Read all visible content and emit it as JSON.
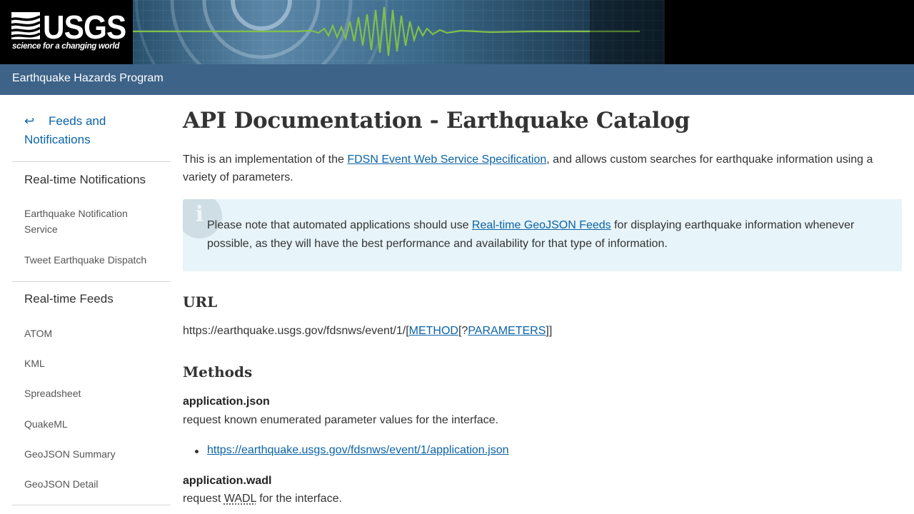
{
  "header": {
    "logo_text": "USGS",
    "logo_tagline": "science for a changing world"
  },
  "program_bar": {
    "title": "Earthquake Hazards Program"
  },
  "sidebar": {
    "back_arrow": "↩",
    "back_label": "Feeds and Notifications",
    "sections": [
      {
        "heading": "Real-time Notifications",
        "items": [
          "Earthquake Notification Service",
          "Tweet Earthquake Dispatch"
        ]
      },
      {
        "heading": "Real-time Feeds",
        "items": [
          "ATOM",
          "KML",
          "Spreadsheet",
          "QuakeML",
          "GeoJSON Summary",
          "GeoJSON Detail"
        ]
      }
    ]
  },
  "main": {
    "title": "API Documentation - Earthquake Catalog",
    "intro_before": "This is an implementation of the ",
    "intro_link": "FDSN Event Web Service Specification",
    "intro_after": ", and allows custom searches for earthquake information using a variety of parameters.",
    "alert": {
      "icon": "info-icon",
      "icon_glyph": "i",
      "before": "Please note that automated applications should use ",
      "link": "Real-time GeoJSON Feeds",
      "after": " for displaying earthquake information whenever possible, as they will have the best performance and availability for that type of information."
    },
    "url_section": {
      "heading": "URL",
      "prefix": "https://earthquake.usgs.gov/fdsnws/event/1/[",
      "method_link": "METHOD",
      "mid": "[?",
      "params_link": "PARAMETERS",
      "suffix": "]]"
    },
    "methods_section": {
      "heading": "Methods",
      "methods": [
        {
          "name": "application.json",
          "description": "request known enumerated parameter values for the interface.",
          "link": "https://earthquake.usgs.gov/fdsnws/event/1/application.json"
        },
        {
          "name": "application.wadl",
          "description_before": "request ",
          "description_abbr": "WADL",
          "description_after": " for the interface."
        }
      ]
    }
  },
  "colors": {
    "header_bg": "#000000",
    "program_bar": "#3e6389",
    "link": "#0b63a6",
    "alert_bg": "#e7f4f9",
    "seismograph": "#7fc04a"
  }
}
